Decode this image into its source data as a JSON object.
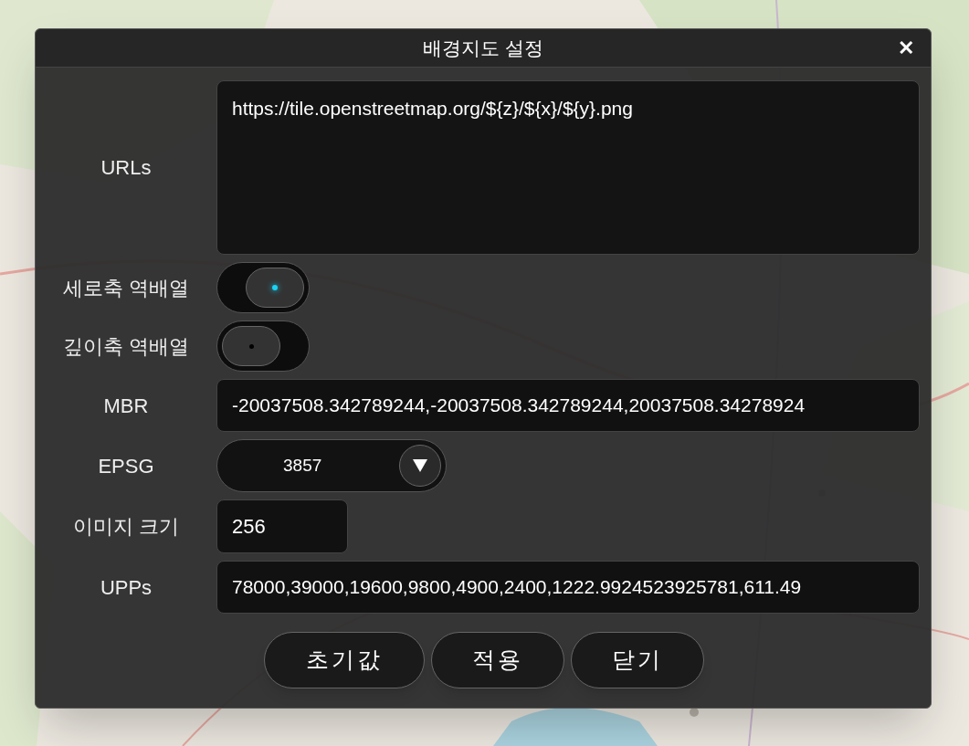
{
  "dialog": {
    "title": "배경지도 설정",
    "close": "✕"
  },
  "fields": [
    {
      "kind": "textarea",
      "label": "URLs",
      "value": "https://tile.openstreetmap.org/${z}/${x}/${y}.png"
    },
    {
      "kind": "toggle",
      "label": "세로축 역배열",
      "on": true
    },
    {
      "kind": "toggle",
      "label": "깊이축 역배열",
      "on": false
    },
    {
      "kind": "text",
      "label": "MBR",
      "value": "-20037508.342789244,-20037508.342789244,20037508.34278924"
    },
    {
      "kind": "select",
      "label": "EPSG",
      "value": "3857"
    },
    {
      "kind": "short",
      "label": "이미지 크기",
      "value": "256"
    },
    {
      "kind": "text",
      "label": "UPPs",
      "value": "78000,39000,19600,9800,4900,2400,1222.9924523925781,611.49"
    }
  ],
  "buttons": [
    "초기값",
    "적용",
    "닫기"
  ]
}
